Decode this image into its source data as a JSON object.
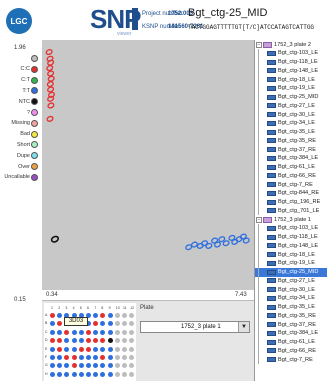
{
  "header": {
    "logo_text": "LGC",
    "app_name": "SNP",
    "app_subname": "viewer",
    "project_number_label": "Project number",
    "project_number": "1752.003",
    "ksnp_number_label": "KSNP number",
    "ksnp_number": "141560-7261",
    "assay_title": "Bgt_ctg-25_MID",
    "sequence": "TACTGGAGTTTTTGT[T/C]ATCCATAGTCATTGG"
  },
  "legend": [
    {
      "label": "",
      "color": "#bdbdbd"
    },
    {
      "label": "C:C",
      "color": "#e53030"
    },
    {
      "label": "C:T",
      "color": "#35b54a"
    },
    {
      "label": "T:T",
      "color": "#2f6fde"
    },
    {
      "label": "NTC",
      "color": "#111111"
    },
    {
      "label": "?",
      "color": "#f08ff0"
    },
    {
      "label": "Missing",
      "color": "#f0a0a0"
    },
    {
      "label": "Bad",
      "color": "#f5ea3c"
    },
    {
      "label": "Short",
      "color": "#a9f0c0"
    },
    {
      "label": "Dupe",
      "color": "#7ee0f0"
    },
    {
      "label": "Over",
      "color": "#f0a040"
    },
    {
      "label": "Uncallable",
      "color": "#9a4dc4"
    }
  ],
  "plot": {
    "y_top": "1.96",
    "y_bottom": "0.15",
    "x_left": "0.34",
    "x_right": "7.43"
  },
  "chart_data": {
    "type": "scatter",
    "xlim": [
      0.34,
      7.43
    ],
    "ylim": [
      0.15,
      1.96
    ],
    "series": [
      {
        "name": "C:C",
        "color": "#e53030",
        "points": [
          [
            0.45,
            1.9
          ],
          [
            0.48,
            1.85
          ],
          [
            0.5,
            1.82
          ],
          [
            0.47,
            1.78
          ],
          [
            0.5,
            1.74
          ],
          [
            0.52,
            1.7
          ],
          [
            0.49,
            1.66
          ],
          [
            0.5,
            1.62
          ],
          [
            0.53,
            1.58
          ],
          [
            0.5,
            1.55
          ],
          [
            0.51,
            1.5
          ],
          [
            0.48,
            1.4
          ]
        ]
      },
      {
        "name": "T:T",
        "color": "#2f6fde",
        "points": [
          [
            5.3,
            0.44
          ],
          [
            5.5,
            0.46
          ],
          [
            5.7,
            0.45
          ],
          [
            5.85,
            0.47
          ],
          [
            6.0,
            0.45
          ],
          [
            6.2,
            0.49
          ],
          [
            6.3,
            0.46
          ],
          [
            6.45,
            0.5
          ],
          [
            6.6,
            0.47
          ],
          [
            6.8,
            0.51
          ],
          [
            6.9,
            0.48
          ],
          [
            7.05,
            0.5
          ],
          [
            7.2,
            0.52
          ],
          [
            7.3,
            0.49
          ]
        ]
      },
      {
        "name": "NTC",
        "color": "#111111",
        "points": [
          [
            0.65,
            0.5
          ]
        ]
      }
    ]
  },
  "plate": {
    "label": "Plate",
    "selected": "1752_3 plate 1",
    "well_tag": "3D03",
    "col_headers": [
      "1",
      "2",
      "3",
      "4",
      "5",
      "6",
      "7",
      "8",
      "9",
      "10",
      "11",
      "12"
    ],
    "row_headers": [
      "A",
      "B",
      "C",
      "D",
      "E",
      "F",
      "G",
      "H"
    ],
    "wells": [
      [
        "R",
        "B",
        "B",
        "B",
        "B",
        "B",
        "B",
        "R",
        "B",
        "G",
        "G",
        "G"
      ],
      [
        "B",
        "R",
        "R",
        "B",
        "B",
        "B",
        "R",
        "B",
        "B",
        "G",
        "G",
        "G"
      ],
      [
        "B",
        "B",
        "R",
        "B",
        "B",
        "R",
        "B",
        "B",
        "B",
        "G",
        "G",
        "G"
      ],
      [
        "R",
        "R",
        "B",
        "B",
        "B",
        "R",
        "R",
        "R",
        "K",
        "G",
        "G",
        "G"
      ],
      [
        "B",
        "R",
        "B",
        "B",
        "R",
        "R",
        "B",
        "B",
        "B",
        "G",
        "G",
        "G"
      ],
      [
        "B",
        "B",
        "R",
        "R",
        "B",
        "B",
        "B",
        "R",
        "B",
        "G",
        "G",
        "G"
      ],
      [
        "B",
        "B",
        "B",
        "R",
        "B",
        "B",
        "B",
        "B",
        "B",
        "G",
        "G",
        "G"
      ],
      [
        "B",
        "B",
        "B",
        "B",
        "B",
        "B",
        "B",
        "B",
        "B",
        "G",
        "G",
        "G"
      ]
    ]
  },
  "tree": {
    "groups": [
      {
        "name": "1752_3 plate 2",
        "items": [
          "Bgt_ctg-103_LE",
          "Bgt_ctg-118_LE",
          "Bgt_ctg-148_LE",
          "Bgt_ctg-18_LE",
          "Bgt_ctg-19_LE",
          "Bgt_ctg-25_MID",
          "Bgt_ctg-27_LE",
          "Bgt_ctg-30_LE",
          "Bgt_ctg-34_LE",
          "Bgt_ctg-35_LE",
          "Bgt_ctg-35_RE",
          "Bgt_ctg-37_RE",
          "Bgt_ctg-384_LE",
          "Bgt_ctg-61_LE",
          "Bgt_ctg-66_RE",
          "Bgt_ctg-7_RE",
          "Bgt_ctg-844_RE",
          "Bgt_ctg_196_RE",
          "Bgt_ctg_701_LE"
        ]
      },
      {
        "name": "1752_3 plate 1",
        "items": [
          "Bgt_ctg-103_LE",
          "Bgt_ctg-118_LE",
          "Bgt_ctg-148_LE",
          "Bgt_ctg-18_LE",
          "Bgt_ctg-19_LE",
          "Bgt_ctg-25_MID",
          "Bgt_ctg-27_LE",
          "Bgt_ctg-30_LE",
          "Bgt_ctg-34_LE",
          "Bgt_ctg-35_LE",
          "Bgt_ctg-35_RE",
          "Bgt_ctg-37_RE",
          "Bgt_ctg-384_LE",
          "Bgt_ctg-61_LE",
          "Bgt_ctg-66_RE",
          "Bgt_ctg-7_RE"
        ]
      }
    ],
    "selected_group": 1,
    "selected_item": 5
  }
}
